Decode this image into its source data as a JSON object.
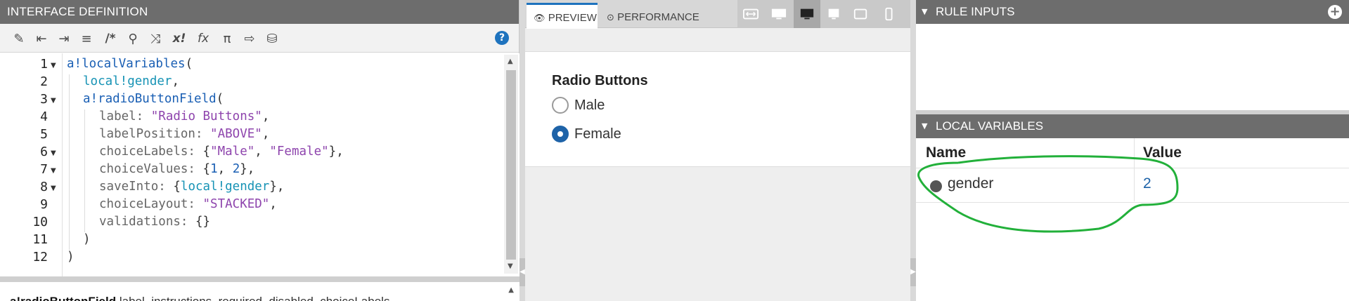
{
  "editor": {
    "title": "INTERFACE DEFINITION",
    "toolbar": [
      {
        "name": "magic-wand-icon",
        "glyph": "✎"
      },
      {
        "name": "outdent-icon",
        "glyph": "⇤"
      },
      {
        "name": "indent-icon",
        "glyph": "⇥"
      },
      {
        "name": "format-icon",
        "glyph": "≡"
      },
      {
        "name": "comment-icon",
        "glyph": "/*"
      },
      {
        "name": "search-icon",
        "glyph": "⚲"
      },
      {
        "name": "shuffle-icon",
        "glyph": "⤨"
      },
      {
        "name": "expression-icon",
        "glyph": "x!"
      },
      {
        "name": "function-icon",
        "glyph": "fx"
      },
      {
        "name": "pi-icon",
        "glyph": "π"
      },
      {
        "name": "export-icon",
        "glyph": "⇨"
      },
      {
        "name": "database-search-icon",
        "glyph": "⛁"
      }
    ],
    "help": "?",
    "line_numbers": [
      "1",
      "2",
      "3",
      "4",
      "5",
      "6",
      "7",
      "8",
      "9",
      "10",
      "11",
      "12"
    ],
    "code": {
      "l1_fn": "a!localVariables",
      "l1_p": "(",
      "l2_var": "local!gender",
      "l2_p": ",",
      "l3_fn": "a!radioButtonField",
      "l3_p": "(",
      "l4_k": "label: ",
      "l4_s": "\"Radio Buttons\"",
      "l4_p": ",",
      "l5_k": "labelPosition: ",
      "l5_s": "\"ABOVE\"",
      "l5_p": ",",
      "l6_k": "choiceLabels: ",
      "l6_b1": "{",
      "l6_s1": "\"Male\"",
      "l6_c": ", ",
      "l6_s2": "\"Female\"",
      "l6_b2": "}",
      "l6_p": ",",
      "l7_k": "choiceValues: ",
      "l7_b1": "{",
      "l7_n1": "1",
      "l7_c": ", ",
      "l7_n2": "2",
      "l7_b2": "}",
      "l7_p": ",",
      "l8_k": "saveInto: ",
      "l8_b1": "{",
      "l8_v": "local!gender",
      "l8_b2": "}",
      "l8_p": ",",
      "l9_k": "choiceLayout: ",
      "l9_s": "\"STACKED\"",
      "l9_p": ",",
      "l10_k": "validations: ",
      "l10_b": "{}",
      "l11": ")",
      "l12": ")"
    },
    "doc_fn": "a!radioButtonField",
    "doc_params": "  label, instructions, required, disabled, choiceLabels,"
  },
  "preview": {
    "tabs": [
      {
        "label": "PREVIEW",
        "icon": "👁"
      },
      {
        "label": "PERFORMANCE",
        "icon": "⊙"
      }
    ],
    "field_label": "Radio Buttons",
    "options": [
      {
        "label": "Male",
        "checked": false
      },
      {
        "label": "Female",
        "checked": true
      }
    ]
  },
  "rule_inputs": {
    "title": "RULE INPUTS"
  },
  "local_variables": {
    "title": "LOCAL VARIABLES",
    "columns": [
      "Name",
      "Value"
    ],
    "rows": [
      {
        "name": "gender",
        "value": "2"
      }
    ]
  },
  "colors": {
    "accent": "#1e73be",
    "header_bg": "#6d6d6d",
    "annotation": "#22b03a"
  }
}
